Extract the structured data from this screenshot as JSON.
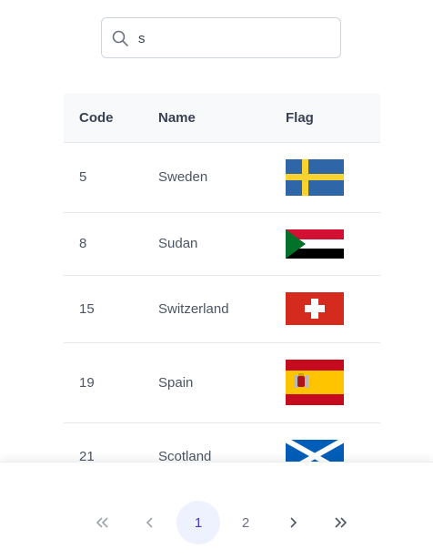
{
  "search": {
    "value": "s",
    "placeholder": ""
  },
  "table": {
    "headers": {
      "code": "Code",
      "name": "Name",
      "flag": "Flag"
    },
    "rows": [
      {
        "code": "5",
        "name": "Sweden",
        "flag_icon": "sweden-flag-icon"
      },
      {
        "code": "8",
        "name": "Sudan",
        "flag_icon": "sudan-flag-icon"
      },
      {
        "code": "15",
        "name": "Switzerland",
        "flag_icon": "switzerland-flag-icon"
      },
      {
        "code": "19",
        "name": "Spain",
        "flag_icon": "spain-flag-icon"
      },
      {
        "code": "21",
        "name": "Scotland",
        "flag_icon": "scotland-flag-icon"
      }
    ]
  },
  "paginator": {
    "first_icon": "double-chevron-left-icon",
    "prev_icon": "chevron-left-icon",
    "pages": [
      "1",
      "2"
    ],
    "current_page": "1",
    "next_icon": "chevron-right-icon",
    "last_icon": "double-chevron-right-icon"
  },
  "colors": {
    "active_page_bg": "#eef2ff",
    "active_page_text": "#4338ca",
    "header_bg": "#f8f9fa"
  }
}
